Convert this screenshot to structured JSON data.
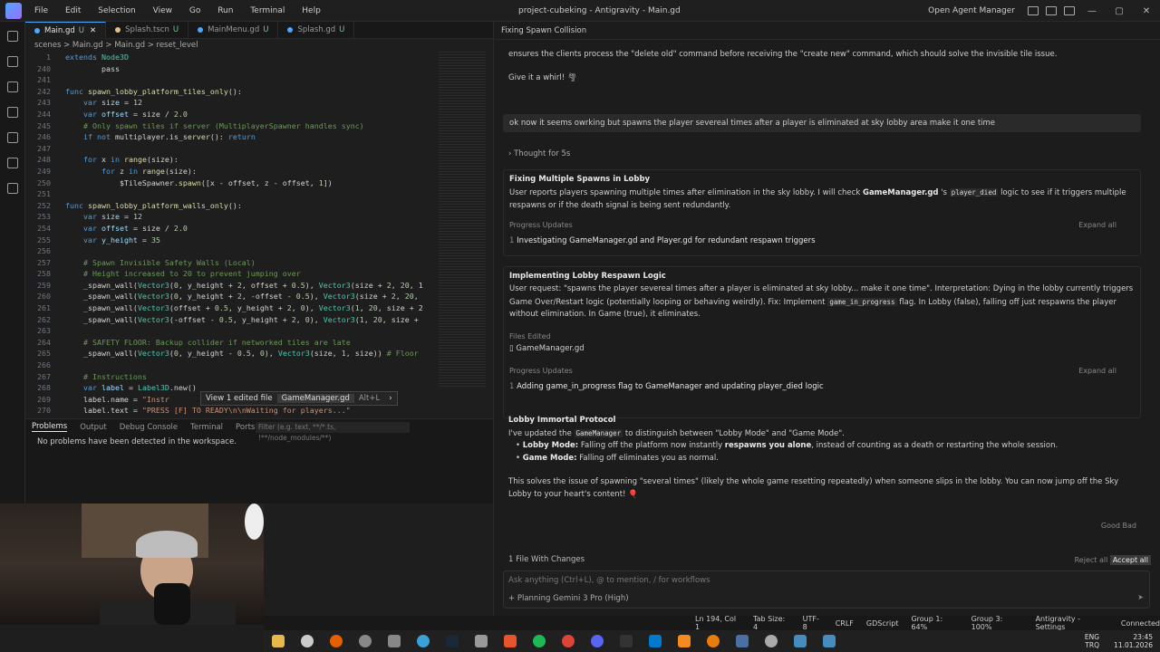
{
  "menu": [
    "File",
    "Edit",
    "Selection",
    "View",
    "Go",
    "Run",
    "Terminal",
    "Help"
  ],
  "window_title": "project-cubeking - Antigravity - Main.gd",
  "open_agent_manager": "Open Agent Manager",
  "tabs": [
    {
      "label": "Main.gd",
      "badge": "U",
      "color": "#4aa8ff"
    },
    {
      "label": "Splash.tscn",
      "badge": "U",
      "color": "#e2c08d"
    },
    {
      "label": "MainMenu.gd",
      "badge": "U",
      "color": "#4aa8ff"
    },
    {
      "label": "Splash.gd",
      "badge": "U",
      "color": "#4aa8ff"
    }
  ],
  "breadcrumb": "scenes > Main.gd > Main.gd > reset_level",
  "hint": {
    "view": "View 1 edited file",
    "file": "GameManager.gd",
    "keys": "Alt+L"
  },
  "panel": {
    "tabs": [
      "Problems",
      "Output",
      "Debug Console",
      "Terminal",
      "Ports"
    ],
    "filter": "Filter (e.g. text, **/*.ts, !**/node_modules/**)",
    "message": "No problems have been detected in the workspace."
  },
  "chat": {
    "header": "Fixing Spawn Collision",
    "prev_text": "ensures the clients process the \"delete old\" command before receiving the \"create new\" command, which should solve the invisible tile issue.",
    "give_whirl": "Give it a whirl! 🌪",
    "user_msg": "ok now it seems owrking but spawns the player severeal times after a player is eliminated at sky lobby area make it one time",
    "thought": "Thought for 5s",
    "s1_title": "Fixing Multiple Spawns in Lobby",
    "s1_text_a": "User reports players spawning multiple times after elimination in the sky lobby. I will check",
    "s1_file": "GameManager.gd",
    "s1_code": "player_died",
    "s1_text_b": "logic to see if it triggers multiple respawns or if the death signal is being sent redundantly.",
    "progress_label": "Progress Updates",
    "expand_all": "Expand all",
    "p1": "Investigating GameManager.gd and Player.gd for redundant respawn triggers",
    "s2_title": "Implementing Lobby Respawn Logic",
    "s2_text_a": "User request: \"spawns the player severeal times after a player is eliminated at sky lobby... make it one time\". Interpretation: Dying in the lobby currently triggers Game Over/Restart",
    "s2_text_b": "logic (potentially looping or behaving weirdly). Fix: Implement",
    "s2_code": "game_in_progress",
    "s2_text_c": "flag. In Lobby (false), falling off just respawns the player without elimination. In Game (true), it",
    "s2_text_d": "eliminates.",
    "files_edited": "Files Edited",
    "edited_file": "GameManager.gd",
    "p2": "Adding game_in_progress flag to GameManager and updating player_died logic",
    "s3_title": "Lobby Immortal Protocol",
    "s3_intro_a": "I've updated the",
    "s3_code": "GameManager",
    "s3_intro_b": "to distinguish between \"Lobby Mode\" and \"Game Mode\".",
    "b1_label": "Lobby Mode:",
    "b1_a": "Falling off the platform now instantly",
    "b1_bold": "respawns you alone",
    "b1_b": ", instead of counting as a death or restarting the whole session.",
    "b2_label": "Game Mode:",
    "b2_text": "Falling off eliminates you as normal.",
    "s3_out_a": "This solves the issue of spawning \"several times\" (likely the whole game resetting repeatedly) when someone slips in the lobby. You can now jump off the Sky Lobby to your heart's",
    "s3_out_b": "content! 🎈",
    "good": "Good",
    "bad": "Bad",
    "changes": "1 File With Changes",
    "reject_all": "Reject all",
    "accept_all": "Accept all",
    "input_placeholder": "Ask anything (Ctrl+L), @ to mention, / for workflows",
    "mode": "Planning",
    "model": "Gemini 3 Pro (High)"
  },
  "status": [
    "Ln 194, Col 1",
    "Tab Size: 4",
    "UTF-8",
    "CRLF",
    "GDScript",
    "Group 1: 64%",
    "Group 3: 100%",
    "Antigravity - Settings",
    "Connected"
  ],
  "tray": {
    "lang": "ENG",
    "region": "TRQ",
    "time": "23:45",
    "date": "11.01.2026"
  }
}
